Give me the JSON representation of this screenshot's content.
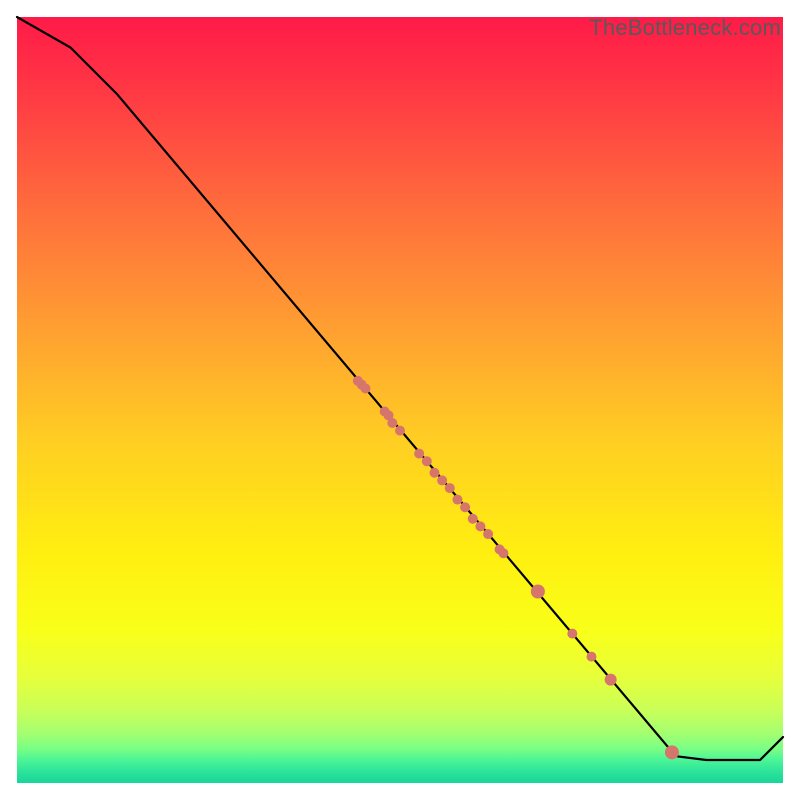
{
  "attribution": "TheBottleneck.com",
  "colors": {
    "dot": "#d6756c",
    "line": "#000000",
    "attribution_text": "#58595b"
  },
  "gradient_stops": [
    {
      "offset": 0.0,
      "color": "#ff1a48"
    },
    {
      "offset": 0.1,
      "color": "#ff3944"
    },
    {
      "offset": 0.25,
      "color": "#ff6d3c"
    },
    {
      "offset": 0.4,
      "color": "#ff9d32"
    },
    {
      "offset": 0.55,
      "color": "#ffcd23"
    },
    {
      "offset": 0.7,
      "color": "#ffef10"
    },
    {
      "offset": 0.8,
      "color": "#f9ff18"
    },
    {
      "offset": 0.86,
      "color": "#e7ff3a"
    },
    {
      "offset": 0.905,
      "color": "#c9ff58"
    },
    {
      "offset": 0.935,
      "color": "#a4ff70"
    },
    {
      "offset": 0.955,
      "color": "#7aff84"
    },
    {
      "offset": 0.97,
      "color": "#4bf597"
    },
    {
      "offset": 0.985,
      "color": "#2de39a"
    },
    {
      "offset": 1.0,
      "color": "#18d69a"
    }
  ],
  "chart_data": {
    "type": "line",
    "title": "",
    "xlabel": "",
    "ylabel": "",
    "xlim": [
      0,
      100
    ],
    "ylim": [
      0,
      100
    ],
    "series": [
      {
        "name": "curve",
        "x": [
          0,
          7,
          13,
          86,
          90,
          97,
          100
        ],
        "y": [
          100,
          96,
          90,
          3.5,
          3,
          3,
          6
        ]
      }
    ],
    "points": [
      {
        "x": 44.5,
        "y": 52.5,
        "r": 5
      },
      {
        "x": 45.0,
        "y": 52.0,
        "r": 5
      },
      {
        "x": 45.5,
        "y": 51.5,
        "r": 5
      },
      {
        "x": 48.0,
        "y": 48.5,
        "r": 5
      },
      {
        "x": 48.5,
        "y": 48.0,
        "r": 5
      },
      {
        "x": 49.0,
        "y": 47.0,
        "r": 5
      },
      {
        "x": 50.0,
        "y": 46.0,
        "r": 5
      },
      {
        "x": 52.5,
        "y": 43.0,
        "r": 5
      },
      {
        "x": 53.5,
        "y": 42.0,
        "r": 5
      },
      {
        "x": 54.5,
        "y": 40.5,
        "r": 5
      },
      {
        "x": 55.5,
        "y": 39.5,
        "r": 5
      },
      {
        "x": 56.5,
        "y": 38.5,
        "r": 5
      },
      {
        "x": 57.5,
        "y": 37.0,
        "r": 5
      },
      {
        "x": 58.5,
        "y": 36.0,
        "r": 5
      },
      {
        "x": 59.5,
        "y": 34.5,
        "r": 5
      },
      {
        "x": 60.5,
        "y": 33.5,
        "r": 5
      },
      {
        "x": 61.5,
        "y": 32.5,
        "r": 5
      },
      {
        "x": 63.0,
        "y": 30.5,
        "r": 5
      },
      {
        "x": 63.5,
        "y": 30.0,
        "r": 5
      },
      {
        "x": 68.0,
        "y": 25.0,
        "r": 7
      },
      {
        "x": 72.5,
        "y": 19.5,
        "r": 5
      },
      {
        "x": 75.0,
        "y": 16.5,
        "r": 5
      },
      {
        "x": 77.5,
        "y": 13.5,
        "r": 6
      },
      {
        "x": 85.5,
        "y": 4.0,
        "r": 7
      }
    ]
  }
}
